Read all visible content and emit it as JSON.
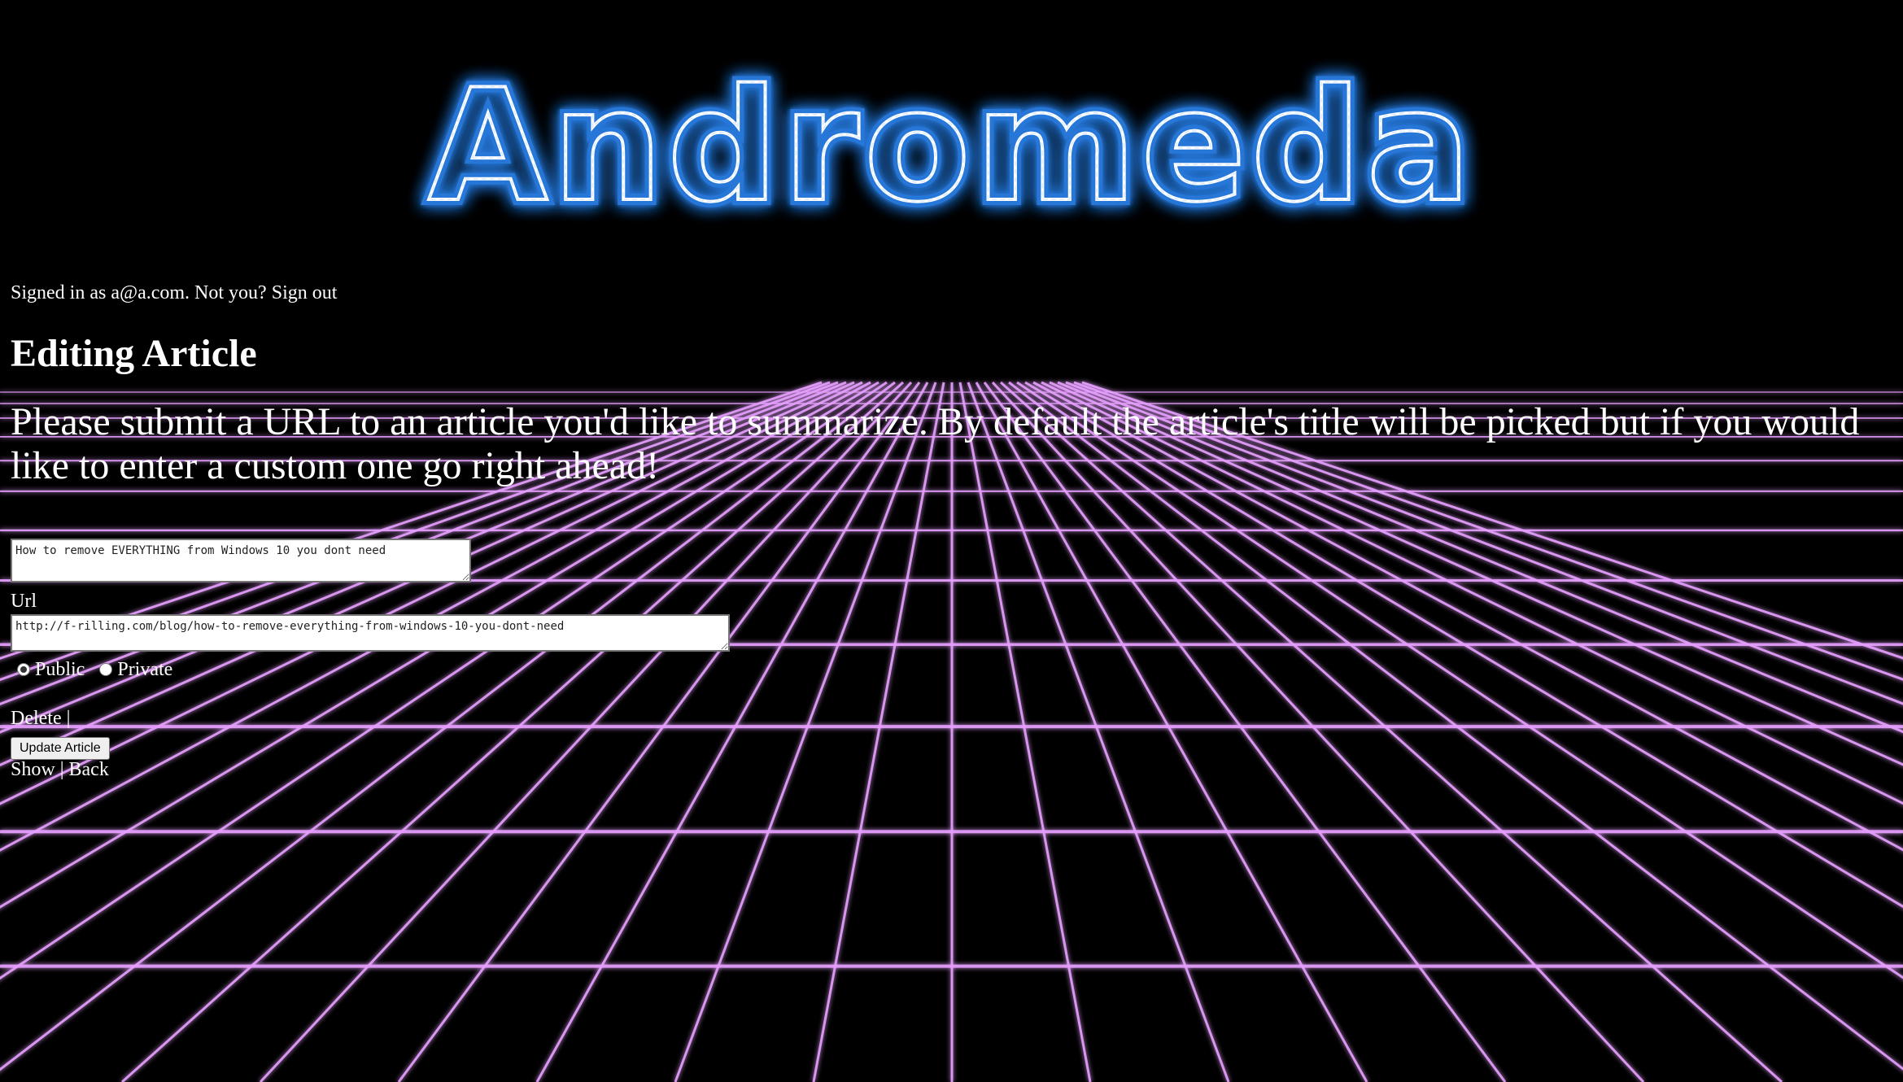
{
  "header": {
    "logo_text": "Andromeda",
    "glow_color": "#1e90ff"
  },
  "auth": {
    "signed_in_prefix": "Signed in as a@a.com. Not you?",
    "sign_out_label": "Sign out"
  },
  "page": {
    "title": "Editing Article",
    "intro": "Please submit a URL to an article you'd like to summarize. By default the article's title will be picked but if you would like to enter a custom one go right ahead!"
  },
  "form": {
    "title_value": "How to remove EVERYTHING from Windows 10 you dont need",
    "url_label": "Url",
    "url_value": "http://f-rilling.com/blog/how-to-remove-everything-from-windows-10-you-dont-need",
    "visibility": {
      "public_label": "Public",
      "private_label": "Private",
      "selected": "Public"
    },
    "delete_label": "Delete",
    "delete_separator": "|",
    "submit_label": "Update Article"
  },
  "nav": {
    "show_label": "Show",
    "separator": "|",
    "back_label": "Back"
  },
  "theme": {
    "grid_color": "#e7a0ff",
    "background": "#000000"
  }
}
